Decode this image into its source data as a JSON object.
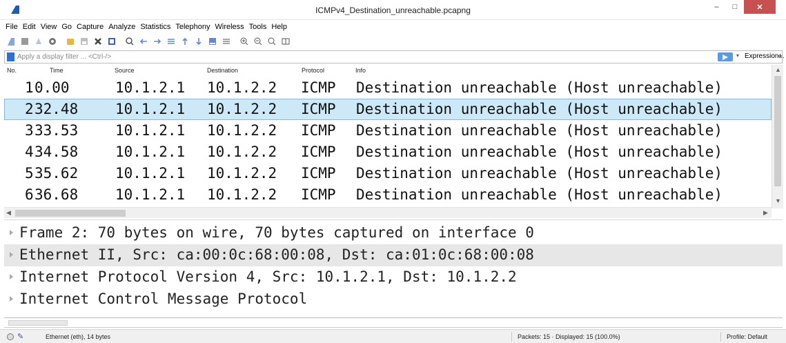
{
  "window": {
    "title": "ICMPv4_Destination_unreachable.pcapng",
    "minimize": "–",
    "maximize": "□",
    "close": "✕"
  },
  "menu": [
    "File",
    "Edit",
    "View",
    "Go",
    "Capture",
    "Analyze",
    "Statistics",
    "Telephony",
    "Wireless",
    "Tools",
    "Help"
  ],
  "toolbar_icons": [
    "shark-fin-start-icon",
    "stop-icon",
    "restart-icon",
    "options-icon",
    "open-file-icon",
    "save-file-icon",
    "close-file-icon",
    "reload-icon",
    "find-icon",
    "back-icon",
    "forward-icon",
    "go-to-packet-icon",
    "first-packet-icon",
    "last-packet-icon",
    "autoscroll-icon",
    "colorize-icon",
    "zoom-in-icon",
    "zoom-out-icon",
    "normal-size-icon",
    "resize-columns-icon"
  ],
  "filter": {
    "placeholder": "Apply a display filter ... <Ctrl-/>",
    "expression": "Expression...",
    "add": "+"
  },
  "packet_list": {
    "columns": [
      "No.",
      "Time",
      "Source",
      "Destination",
      "Protocol",
      "Info"
    ],
    "rows": [
      {
        "no": "1",
        "time": "0.00",
        "source": "10.1.2.1",
        "destination": "10.1.2.2",
        "protocol": "ICMP",
        "info": "Destination unreachable (Host unreachable)"
      },
      {
        "no": "2",
        "time": "32.48",
        "source": "10.1.2.1",
        "destination": "10.1.2.2",
        "protocol": "ICMP",
        "info": "Destination unreachable (Host unreachable)"
      },
      {
        "no": "3",
        "time": "33.53",
        "source": "10.1.2.1",
        "destination": "10.1.2.2",
        "protocol": "ICMP",
        "info": "Destination unreachable (Host unreachable)"
      },
      {
        "no": "4",
        "time": "34.58",
        "source": "10.1.2.1",
        "destination": "10.1.2.2",
        "protocol": "ICMP",
        "info": "Destination unreachable (Host unreachable)"
      },
      {
        "no": "5",
        "time": "35.62",
        "source": "10.1.2.1",
        "destination": "10.1.2.2",
        "protocol": "ICMP",
        "info": "Destination unreachable (Host unreachable)"
      },
      {
        "no": "6",
        "time": "36.68",
        "source": "10.1.2.1",
        "destination": "10.1.2.2",
        "protocol": "ICMP",
        "info": "Destination unreachable (Host unreachable)"
      }
    ],
    "selected_index": 1
  },
  "details": [
    "Frame 2: 70 bytes on wire, 70 bytes captured on interface 0",
    "Ethernet II, Src: ca:00:0c:68:00:08, Dst: ca:01:0c:68:00:08",
    "Internet Protocol Version 4, Src: 10.1.2.1, Dst: 10.1.2.2",
    "Internet Control Message Protocol"
  ],
  "status": {
    "left": "Ethernet (eth), 14 bytes",
    "packets": "Packets: 15 · Displayed: 15 (100.0%)",
    "profile": "Profile: Default"
  },
  "colors": {
    "selected_row": "#cde8f6",
    "close_button": "#c75050",
    "accent": "#2f6fd6"
  }
}
